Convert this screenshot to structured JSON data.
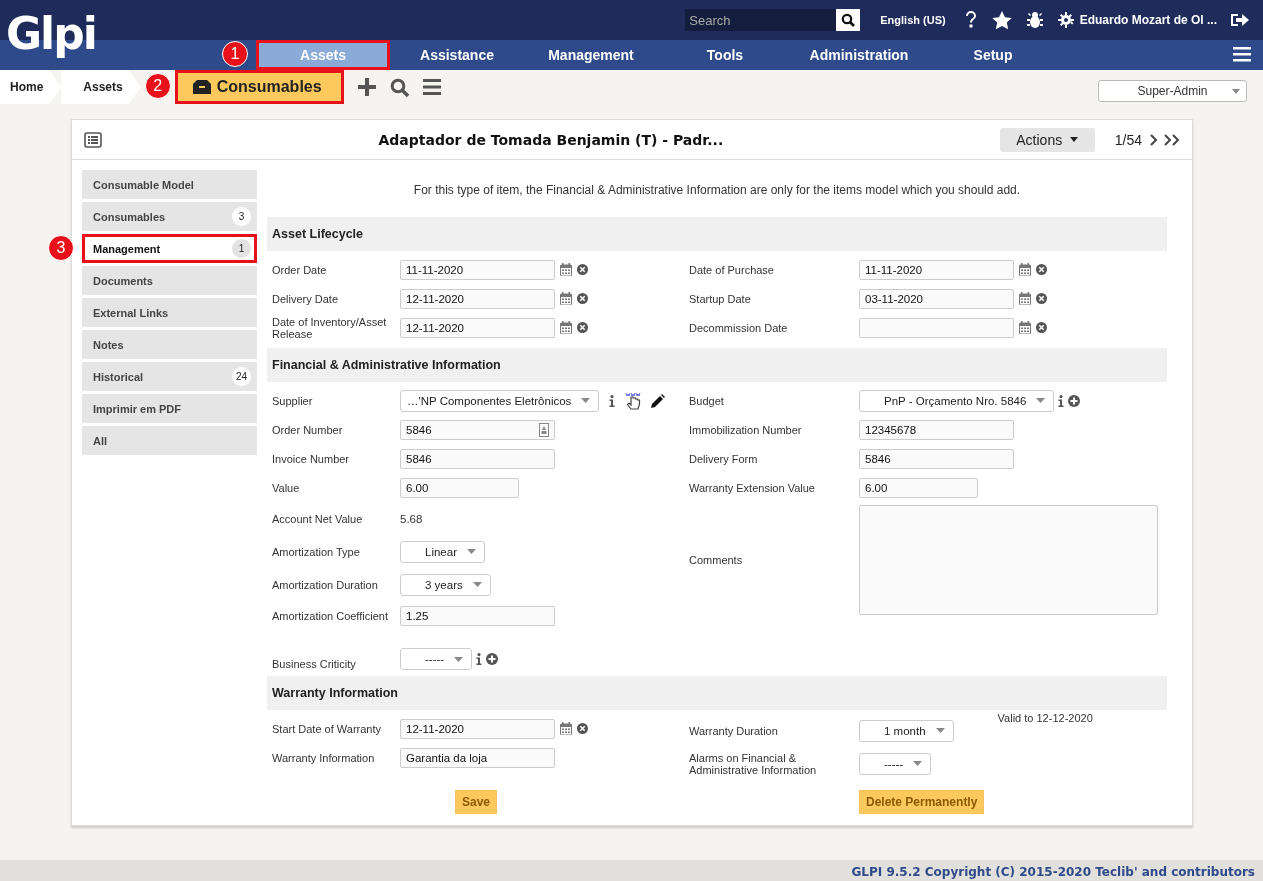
{
  "header": {
    "logo": "Glpi",
    "search": {
      "placeholder": "Search"
    },
    "language": "English (US)",
    "user": "Eduardo Mozart de Ol ..."
  },
  "nav": [
    {
      "label": "Assets",
      "selected": true,
      "callout": "1"
    },
    {
      "label": "Assistance",
      "selected": false
    },
    {
      "label": "Management",
      "selected": false
    },
    {
      "label": "Tools",
      "selected": false
    },
    {
      "label": "Administration",
      "selected": false
    },
    {
      "label": "Setup",
      "selected": false
    }
  ],
  "breadcrumb": [
    {
      "label": "Home",
      "kind": "link"
    },
    {
      "label": "Assets",
      "kind": "link"
    },
    {
      "label": "Consumables",
      "kind": "current",
      "callout": "2"
    }
  ],
  "profile": "Super-Admin",
  "item": {
    "title": "Adaptador de Tomada Benjamin (T) - Padr...",
    "actions": "Actions",
    "position": "1/54"
  },
  "tabs": [
    {
      "label": "Consumable Model",
      "selected": false
    },
    {
      "label": "Consumables",
      "count": "3",
      "selected": false
    },
    {
      "label": "Management",
      "count": "1",
      "selected": true,
      "callout": "3"
    },
    {
      "label": "Documents",
      "selected": false
    },
    {
      "label": "External Links",
      "selected": false
    },
    {
      "label": "Notes",
      "selected": false
    },
    {
      "label": "Historical",
      "count": "24",
      "selected": false
    },
    {
      "label": "Imprimir em PDF",
      "selected": false
    },
    {
      "label": "All",
      "selected": false
    }
  ],
  "notice": "For this type of item, the Financial & Administrative Information are only for the items model which you should add.",
  "sections": [
    {
      "title": "Asset Lifecycle",
      "left": [
        {
          "label": "Order Date",
          "kind": "date",
          "value": "11-11-2020"
        },
        {
          "label": "Delivery Date",
          "kind": "date",
          "value": "12-11-2020"
        },
        {
          "label": "Date of Inventory/Asset Release",
          "kind": "date",
          "value": "12-11-2020"
        }
      ],
      "right": [
        {
          "label": "Date of Purchase",
          "kind": "date",
          "value": "11-11-2020"
        },
        {
          "label": "Startup Date",
          "kind": "date",
          "value": "03-11-2020"
        },
        {
          "label": "Decommission Date",
          "kind": "date"
        }
      ]
    },
    {
      "title": "Financial & Administrative Information",
      "left": [
        {
          "label": "Supplier",
          "kind": "select_linked",
          "value": "…'NP Componentes Eletrônicos"
        },
        {
          "label": "Order Number",
          "kind": "text_autofill",
          "value": "5846"
        },
        {
          "label": "Invoice Number",
          "kind": "text",
          "value": "5846"
        },
        {
          "label": "Value",
          "kind": "number",
          "value": "6.00"
        },
        {
          "label": "Account Net Value",
          "kind": "static",
          "value": "5.68"
        },
        {
          "label": "Amortization Type",
          "kind": "select",
          "value": "Linear"
        },
        {
          "label": "Amortization Duration",
          "kind": "select",
          "value": "3 years"
        },
        {
          "label": "Amortization Coefficient",
          "kind": "text",
          "value": "1.25"
        },
        {
          "label": "Business Criticity",
          "kind": "select_addable",
          "value": "-----"
        }
      ],
      "right": [
        {
          "label": "Budget",
          "kind": "select_addable",
          "value": "PnP - Orçamento Nro. 5846"
        },
        {
          "label": "Immobilization Number",
          "kind": "text",
          "value": "12345678"
        },
        {
          "label": "Delivery Form",
          "kind": "text",
          "value": "5846"
        },
        {
          "label": "Warranty Extension Value",
          "kind": "number",
          "value": "6.00"
        },
        {
          "label": "Comments",
          "kind": "textarea"
        }
      ]
    },
    {
      "title": "Warranty Information",
      "left": [
        {
          "label": "Start Date of Warranty",
          "kind": "date",
          "value": "12-11-2020"
        },
        {
          "label": "Warranty Information",
          "kind": "text",
          "value": "Garantia da loja"
        }
      ],
      "right": [
        {
          "label": "Warranty Duration",
          "kind": "select",
          "value": "1 month",
          "note": "Valid to 12-12-2020"
        },
        {
          "label": "Alarms on Financial & Administrative Information",
          "kind": "select",
          "value": "-----"
        }
      ]
    }
  ],
  "buttons": [
    {
      "label": "Save",
      "kind": "save"
    },
    {
      "label": "Delete Permanently",
      "kind": "delete"
    }
  ],
  "footer": "GLPI 9.5.2 Copyright (C) 2015-2020 Teclib' and contributors"
}
